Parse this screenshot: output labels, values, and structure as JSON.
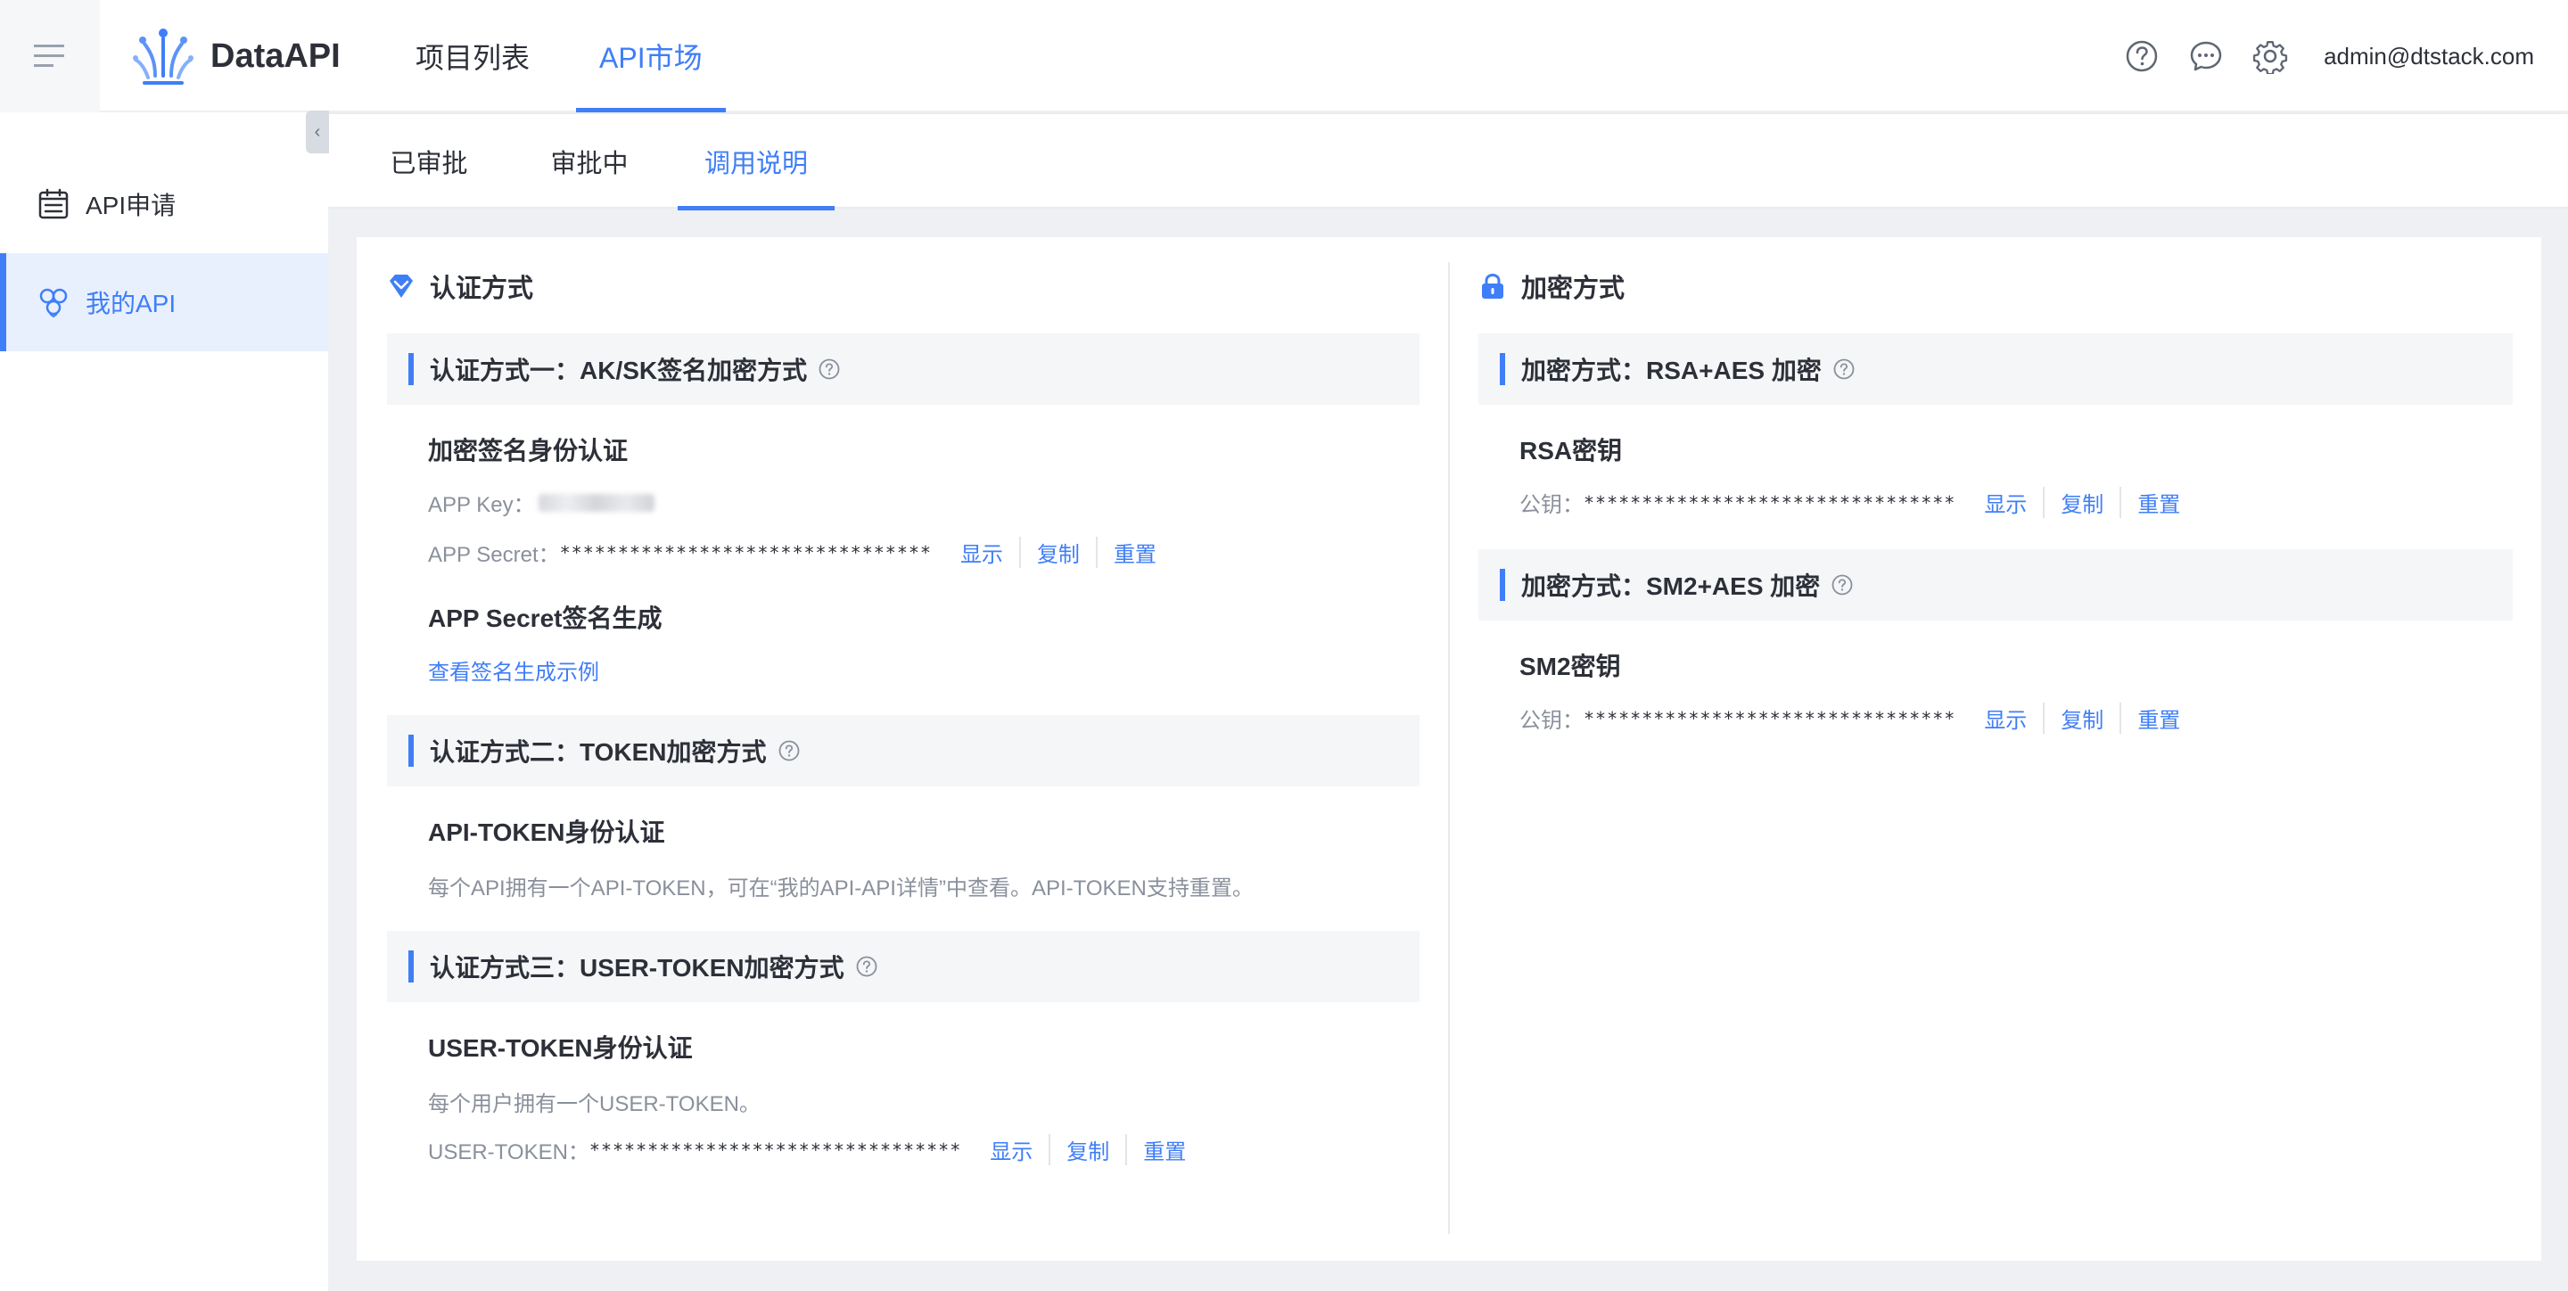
{
  "header": {
    "logo_text": "DataAPI",
    "nav": [
      {
        "label": "项目列表",
        "active": false
      },
      {
        "label": "API市场",
        "active": true
      }
    ],
    "icons": [
      "help-circle-icon",
      "message-icon",
      "settings-gear-icon"
    ],
    "user": "admin@dtstack.com"
  },
  "sidebar": {
    "items": [
      {
        "label": "API申请",
        "icon": "calendar-list-icon",
        "active": false
      },
      {
        "label": "我的API",
        "icon": "cluster-nodes-icon",
        "active": true
      }
    ],
    "collapse_glyph": "‹"
  },
  "subtabs": [
    {
      "label": "已审批",
      "active": false
    },
    {
      "label": "审批中",
      "active": false
    },
    {
      "label": "调用说明",
      "active": true
    }
  ],
  "left": {
    "section_title": "认证方式",
    "method1": {
      "band": "认证方式一：AK/SK签名加密方式",
      "heading": "加密签名身份认证",
      "app_key_label": "APP Key：",
      "app_secret_label": "APP Secret：",
      "app_secret_value": "********************************",
      "secret_heading": "APP Secret签名生成",
      "example_link": "查看签名生成示例"
    },
    "method2": {
      "band": "认证方式二：TOKEN加密方式",
      "heading": "API-TOKEN身份认证",
      "desc": "每个API拥有一个API-TOKEN，可在“我的API-API详情”中查看。API-TOKEN支持重置。"
    },
    "method3": {
      "band": "认证方式三：USER-TOKEN加密方式",
      "heading": "USER-TOKEN身份认证",
      "desc": "每个用户拥有一个USER-TOKEN。",
      "token_label": "USER-TOKEN：",
      "token_value": "********************************"
    }
  },
  "right": {
    "section_title": "加密方式",
    "rsa": {
      "band": "加密方式：RSA+AES 加密",
      "heading": "RSA密钥",
      "key_label": "公钥：",
      "key_value": "********************************"
    },
    "sm2": {
      "band": "加密方式：SM2+AES 加密",
      "heading": "SM2密钥",
      "key_label": "公钥：",
      "key_value": "********************************"
    }
  },
  "actions": {
    "show": "显示",
    "copy": "复制",
    "reset": "重置"
  },
  "colors": {
    "accent": "#3f7ef7",
    "text": "#2d3038",
    "muted": "#8a909c",
    "band_bg": "#f5f6f8"
  }
}
